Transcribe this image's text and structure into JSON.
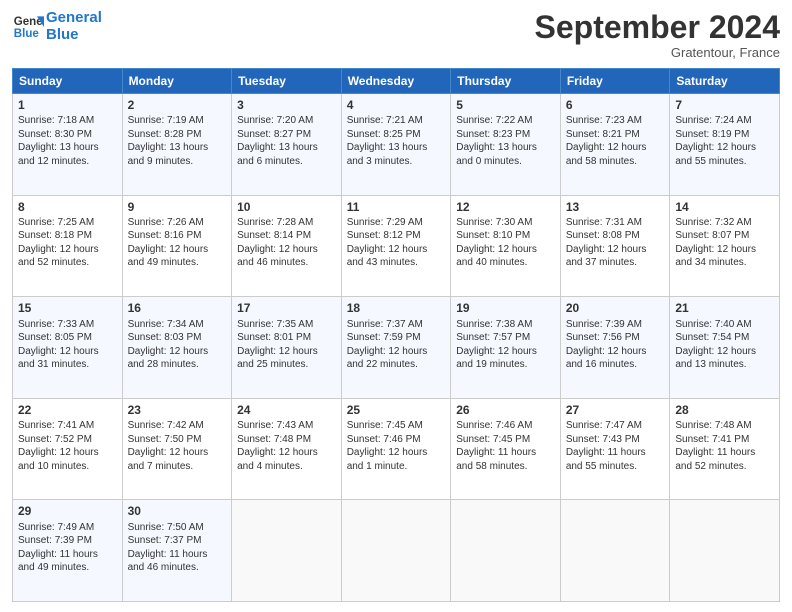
{
  "logo": {
    "line1": "General",
    "line2": "Blue"
  },
  "title": "September 2024",
  "location": "Gratentour, France",
  "days_header": [
    "Sunday",
    "Monday",
    "Tuesday",
    "Wednesday",
    "Thursday",
    "Friday",
    "Saturday"
  ],
  "weeks": [
    [
      {
        "day": "1",
        "sunrise": "Sunrise: 7:18 AM",
        "sunset": "Sunset: 8:30 PM",
        "daylight": "Daylight: 13 hours and 12 minutes."
      },
      {
        "day": "2",
        "sunrise": "Sunrise: 7:19 AM",
        "sunset": "Sunset: 8:28 PM",
        "daylight": "Daylight: 13 hours and 9 minutes."
      },
      {
        "day": "3",
        "sunrise": "Sunrise: 7:20 AM",
        "sunset": "Sunset: 8:27 PM",
        "daylight": "Daylight: 13 hours and 6 minutes."
      },
      {
        "day": "4",
        "sunrise": "Sunrise: 7:21 AM",
        "sunset": "Sunset: 8:25 PM",
        "daylight": "Daylight: 13 hours and 3 minutes."
      },
      {
        "day": "5",
        "sunrise": "Sunrise: 7:22 AM",
        "sunset": "Sunset: 8:23 PM",
        "daylight": "Daylight: 13 hours and 0 minutes."
      },
      {
        "day": "6",
        "sunrise": "Sunrise: 7:23 AM",
        "sunset": "Sunset: 8:21 PM",
        "daylight": "Daylight: 12 hours and 58 minutes."
      },
      {
        "day": "7",
        "sunrise": "Sunrise: 7:24 AM",
        "sunset": "Sunset: 8:19 PM",
        "daylight": "Daylight: 12 hours and 55 minutes."
      }
    ],
    [
      {
        "day": "8",
        "sunrise": "Sunrise: 7:25 AM",
        "sunset": "Sunset: 8:18 PM",
        "daylight": "Daylight: 12 hours and 52 minutes."
      },
      {
        "day": "9",
        "sunrise": "Sunrise: 7:26 AM",
        "sunset": "Sunset: 8:16 PM",
        "daylight": "Daylight: 12 hours and 49 minutes."
      },
      {
        "day": "10",
        "sunrise": "Sunrise: 7:28 AM",
        "sunset": "Sunset: 8:14 PM",
        "daylight": "Daylight: 12 hours and 46 minutes."
      },
      {
        "day": "11",
        "sunrise": "Sunrise: 7:29 AM",
        "sunset": "Sunset: 8:12 PM",
        "daylight": "Daylight: 12 hours and 43 minutes."
      },
      {
        "day": "12",
        "sunrise": "Sunrise: 7:30 AM",
        "sunset": "Sunset: 8:10 PM",
        "daylight": "Daylight: 12 hours and 40 minutes."
      },
      {
        "day": "13",
        "sunrise": "Sunrise: 7:31 AM",
        "sunset": "Sunset: 8:08 PM",
        "daylight": "Daylight: 12 hours and 37 minutes."
      },
      {
        "day": "14",
        "sunrise": "Sunrise: 7:32 AM",
        "sunset": "Sunset: 8:07 PM",
        "daylight": "Daylight: 12 hours and 34 minutes."
      }
    ],
    [
      {
        "day": "15",
        "sunrise": "Sunrise: 7:33 AM",
        "sunset": "Sunset: 8:05 PM",
        "daylight": "Daylight: 12 hours and 31 minutes."
      },
      {
        "day": "16",
        "sunrise": "Sunrise: 7:34 AM",
        "sunset": "Sunset: 8:03 PM",
        "daylight": "Daylight: 12 hours and 28 minutes."
      },
      {
        "day": "17",
        "sunrise": "Sunrise: 7:35 AM",
        "sunset": "Sunset: 8:01 PM",
        "daylight": "Daylight: 12 hours and 25 minutes."
      },
      {
        "day": "18",
        "sunrise": "Sunrise: 7:37 AM",
        "sunset": "Sunset: 7:59 PM",
        "daylight": "Daylight: 12 hours and 22 minutes."
      },
      {
        "day": "19",
        "sunrise": "Sunrise: 7:38 AM",
        "sunset": "Sunset: 7:57 PM",
        "daylight": "Daylight: 12 hours and 19 minutes."
      },
      {
        "day": "20",
        "sunrise": "Sunrise: 7:39 AM",
        "sunset": "Sunset: 7:56 PM",
        "daylight": "Daylight: 12 hours and 16 minutes."
      },
      {
        "day": "21",
        "sunrise": "Sunrise: 7:40 AM",
        "sunset": "Sunset: 7:54 PM",
        "daylight": "Daylight: 12 hours and 13 minutes."
      }
    ],
    [
      {
        "day": "22",
        "sunrise": "Sunrise: 7:41 AM",
        "sunset": "Sunset: 7:52 PM",
        "daylight": "Daylight: 12 hours and 10 minutes."
      },
      {
        "day": "23",
        "sunrise": "Sunrise: 7:42 AM",
        "sunset": "Sunset: 7:50 PM",
        "daylight": "Daylight: 12 hours and 7 minutes."
      },
      {
        "day": "24",
        "sunrise": "Sunrise: 7:43 AM",
        "sunset": "Sunset: 7:48 PM",
        "daylight": "Daylight: 12 hours and 4 minutes."
      },
      {
        "day": "25",
        "sunrise": "Sunrise: 7:45 AM",
        "sunset": "Sunset: 7:46 PM",
        "daylight": "Daylight: 12 hours and 1 minute."
      },
      {
        "day": "26",
        "sunrise": "Sunrise: 7:46 AM",
        "sunset": "Sunset: 7:45 PM",
        "daylight": "Daylight: 11 hours and 58 minutes."
      },
      {
        "day": "27",
        "sunrise": "Sunrise: 7:47 AM",
        "sunset": "Sunset: 7:43 PM",
        "daylight": "Daylight: 11 hours and 55 minutes."
      },
      {
        "day": "28",
        "sunrise": "Sunrise: 7:48 AM",
        "sunset": "Sunset: 7:41 PM",
        "daylight": "Daylight: 11 hours and 52 minutes."
      }
    ],
    [
      {
        "day": "29",
        "sunrise": "Sunrise: 7:49 AM",
        "sunset": "Sunset: 7:39 PM",
        "daylight": "Daylight: 11 hours and 49 minutes."
      },
      {
        "day": "30",
        "sunrise": "Sunrise: 7:50 AM",
        "sunset": "Sunset: 7:37 PM",
        "daylight": "Daylight: 11 hours and 46 minutes."
      },
      null,
      null,
      null,
      null,
      null
    ]
  ]
}
